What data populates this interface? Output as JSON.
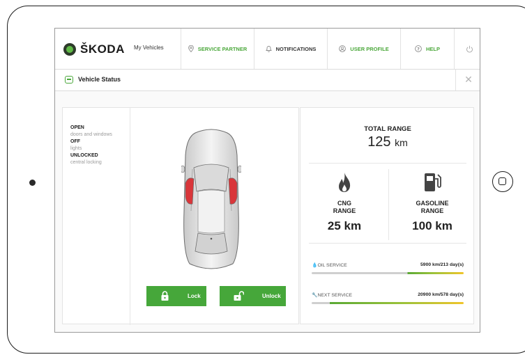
{
  "brand": {
    "name": "ŠKODA"
  },
  "nav": {
    "my_vehicles": "My Vehicles",
    "service_partner": "SERVICE PARTNER",
    "notifications": "NOTIFICATIONS",
    "user_profile": "USER PROFILE",
    "help": "HELP"
  },
  "page": {
    "title": "Vehicle Status",
    "close": "✕"
  },
  "status": {
    "items": [
      {
        "state": "OPEN",
        "label": "doors and windows"
      },
      {
        "state": "OFF",
        "label": "lights"
      },
      {
        "state": "UNLOCKED",
        "label": "central locking"
      }
    ]
  },
  "actions": {
    "lock": "Lock",
    "unlock": "Unlock"
  },
  "range": {
    "total_label": "TOTAL RANGE",
    "total_value": "125",
    "total_unit": "km",
    "cng_label_1": "CNG",
    "cng_label_2": "RANGE",
    "cng_value": "25 km",
    "gas_label_1": "GASOLINE",
    "gas_label_2": "RANGE",
    "gas_value": "100 km"
  },
  "service": {
    "oil_label": "OIL SERVICE",
    "oil_value": "5900 km/213 day(s)",
    "oil_progress": 0.37,
    "next_label": "NEXT SERVICE",
    "next_value": "20900 km/578 day(s)",
    "next_progress": 0.88
  },
  "colors": {
    "accent": "#46a73a",
    "warning": "#f0c52a",
    "brake_light": "#d9363a"
  }
}
